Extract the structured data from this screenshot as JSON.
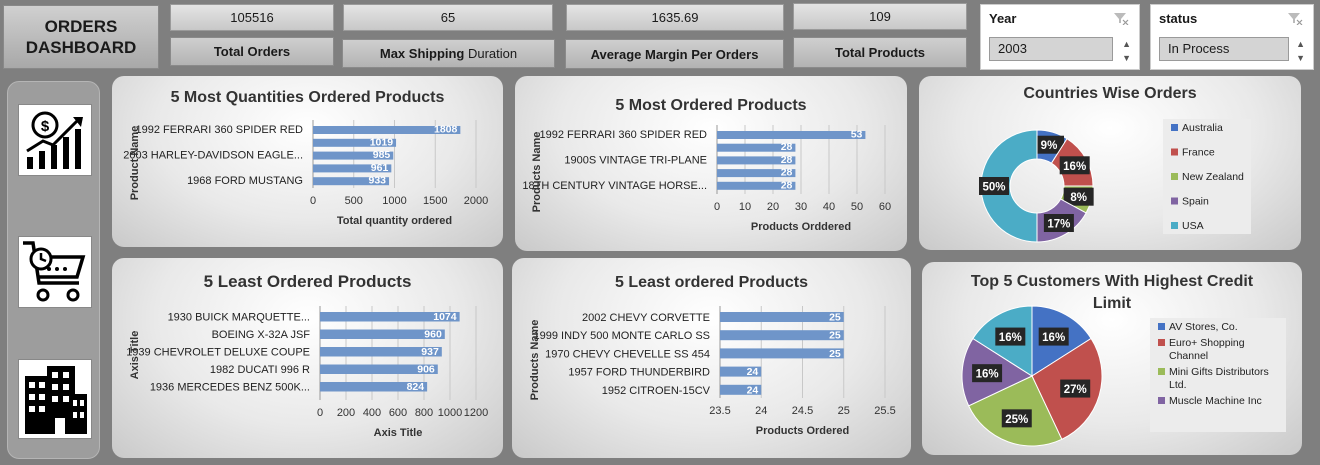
{
  "dashboard_title": "ORDERS DASHBOARD",
  "kpis": [
    {
      "value": "105516",
      "label": "Total Orders"
    },
    {
      "value": "65",
      "label_bold": "Max Shipping",
      "label_rest": " Duration"
    },
    {
      "value": "1635.69",
      "label": "Average Margin Per Orders"
    },
    {
      "value": "109",
      "label": "Total Products"
    }
  ],
  "slicers": [
    {
      "title": "Year",
      "selected": "2003"
    },
    {
      "title": "status",
      "selected": "In Process"
    }
  ],
  "side_icons": [
    "revenue-chart-icon",
    "shopping-cart-icon",
    "buildings-icon"
  ],
  "colors": {
    "bar": "#6f95c9",
    "australia": "#4472c4",
    "france": "#c0504d",
    "new_zealand": "#9bbb59",
    "spain": "#8064a2",
    "usa": "#4bacc6"
  },
  "chart_data": [
    {
      "type": "bar",
      "title": "5 Most Quantities Ordered Products",
      "xlabel": "Total quantity ordered",
      "ylabel": "Product Name",
      "categories": [
        "1992 FERRARI 360 SPIDER RED",
        "",
        "2003 HARLEY-DAVIDSON EAGLE...",
        "",
        "1968 FORD MUSTANG"
      ],
      "values": [
        1808,
        1019,
        985,
        961,
        933
      ],
      "xlim": [
        0,
        2000
      ],
      "ticks": [
        0,
        500,
        1000,
        1500,
        2000
      ],
      "grid": true
    },
    {
      "type": "bar",
      "title": "5 Most Ordered Products",
      "xlabel": "Products Orddered",
      "ylabel": "Products Name",
      "categories": [
        "1992 FERRARI 360 SPIDER RED",
        "",
        "1900S VINTAGE TRI-PLANE",
        "",
        "18TH CENTURY VINTAGE HORSE..."
      ],
      "values": [
        53,
        28,
        28,
        28,
        28
      ],
      "xlim": [
        0,
        60
      ],
      "ticks": [
        0,
        10,
        20,
        30,
        40,
        50,
        60
      ],
      "grid": true
    },
    {
      "type": "pie",
      "title": "Countries Wise Orders",
      "donut": true,
      "labels": [
        "Australia",
        "France",
        "New Zealand",
        "Spain",
        "USA"
      ],
      "values": [
        9,
        16,
        8,
        17,
        50
      ],
      "legend": "right"
    },
    {
      "type": "bar",
      "title": "5 Least Ordered Products",
      "xlabel": "Axis Title",
      "ylabel": "Axis Title",
      "categories": [
        "1930 BUICK MARQUETTE...",
        "BOEING X-32A JSF",
        "1939 CHEVROLET DELUXE COUPE",
        "1982 DUCATI 996 R",
        "1936 MERCEDES BENZ 500K..."
      ],
      "values": [
        1074,
        960,
        937,
        906,
        824
      ],
      "xlim": [
        0,
        1200
      ],
      "ticks": [
        0,
        200,
        400,
        600,
        800,
        1000,
        1200
      ],
      "grid": true
    },
    {
      "type": "bar",
      "title": "5 Least ordered Products",
      "xlabel": "Products Ordered",
      "ylabel": "Products Name",
      "categories": [
        "2002 CHEVY CORVETTE",
        "1999 INDY 500 MONTE CARLO SS",
        "1970 CHEVY CHEVELLE SS 454",
        "1957 FORD THUNDERBIRD",
        "1952 CITROEN-15CV"
      ],
      "values": [
        25,
        25,
        25,
        24,
        24
      ],
      "xlim": [
        23.5,
        25.5
      ],
      "ticks": [
        23.5,
        24,
        24.5,
        25,
        25.5
      ],
      "grid": true
    },
    {
      "type": "pie",
      "title": "Top 5 Customers With Highest Credit Limit",
      "donut": false,
      "labels": [
        "AV Stores, Co.",
        "Euro+ Shopping Channel",
        "Mini Gifts Distributors Ltd.",
        "Muscle Machine Inc",
        ""
      ],
      "values": [
        16,
        27,
        25,
        16,
        16
      ],
      "legend": "right"
    }
  ]
}
